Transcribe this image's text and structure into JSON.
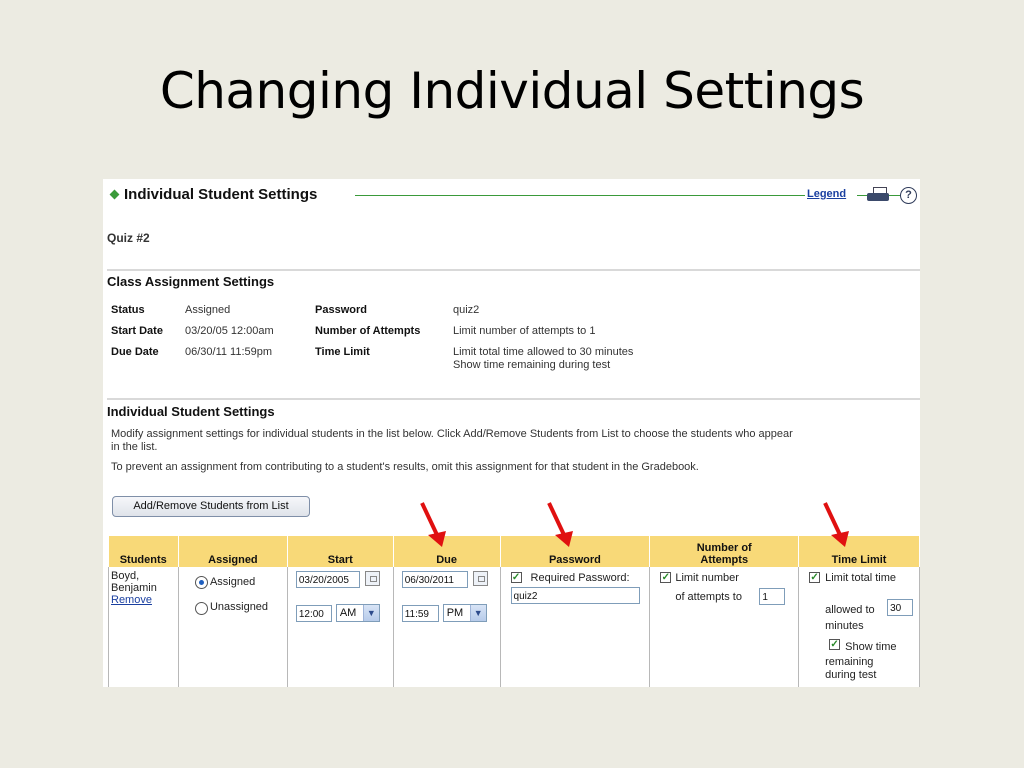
{
  "slide": {
    "title": "Changing Individual Settings"
  },
  "header": {
    "title": "Individual Student Settings",
    "legend_link": "Legend",
    "help_glyph": "?"
  },
  "quiz_name": "Quiz #2",
  "class_settings": {
    "title": "Class Assignment Settings",
    "status_label": "Status",
    "status_value": "Assigned",
    "start_label": "Start Date",
    "start_value": "03/20/05 12:00am",
    "due_label": "Due Date",
    "due_value": "06/30/11 11:59pm",
    "password_label": "Password",
    "password_value": "quiz2",
    "attempts_label": "Number of Attempts",
    "attempts_value": "Limit number of attempts to 1",
    "time_label": "Time Limit",
    "time_value_1": "Limit total time allowed to 30 minutes",
    "time_value_2": "Show time remaining during test"
  },
  "individual": {
    "title": "Individual Student Settings",
    "para1_line1": "Modify assignment settings for individual students in the list below. Click Add/Remove Students from List to choose the students who appear",
    "para1_line2": "in the list.",
    "para2": "To prevent an assignment from contributing to a student's results, omit this assignment for that student in the Gradebook.",
    "add_remove_button": "Add/Remove Students from List"
  },
  "table": {
    "headers": {
      "students": "Students",
      "assigned": "Assigned",
      "start": "Start",
      "due": "Due",
      "password": "Password",
      "attempts_line1": "Number of",
      "attempts_line2": "Attempts",
      "time_limit": "Time Limit"
    },
    "row": {
      "student_line1": "Boyd,",
      "student_line2": "Benjamin",
      "remove_link": "Remove",
      "assigned_option": "Assigned",
      "unassigned_option": "Unassigned",
      "start_date": "03/20/2005",
      "start_time": "12:00",
      "start_ampm": "AM",
      "due_date": "06/30/2011",
      "due_time": "11:59",
      "due_ampm": "PM",
      "password_checkbox_label": "Required Password:",
      "password_value": "quiz2",
      "attempts_label_1": "Limit number",
      "attempts_label_2": "of attempts to",
      "attempts_value": "1",
      "time_label_1": "Limit total time",
      "time_label_2": "allowed to",
      "time_value": "30",
      "time_label_3": "minutes",
      "show_time_1": "Show time",
      "show_time_2": "remaining",
      "show_time_3": "during test"
    }
  },
  "colors": {
    "header_row": "#f8d978",
    "accent_green": "#3a9a3a",
    "arrow_red": "#e01010",
    "link_blue": "#1a3fa0"
  }
}
